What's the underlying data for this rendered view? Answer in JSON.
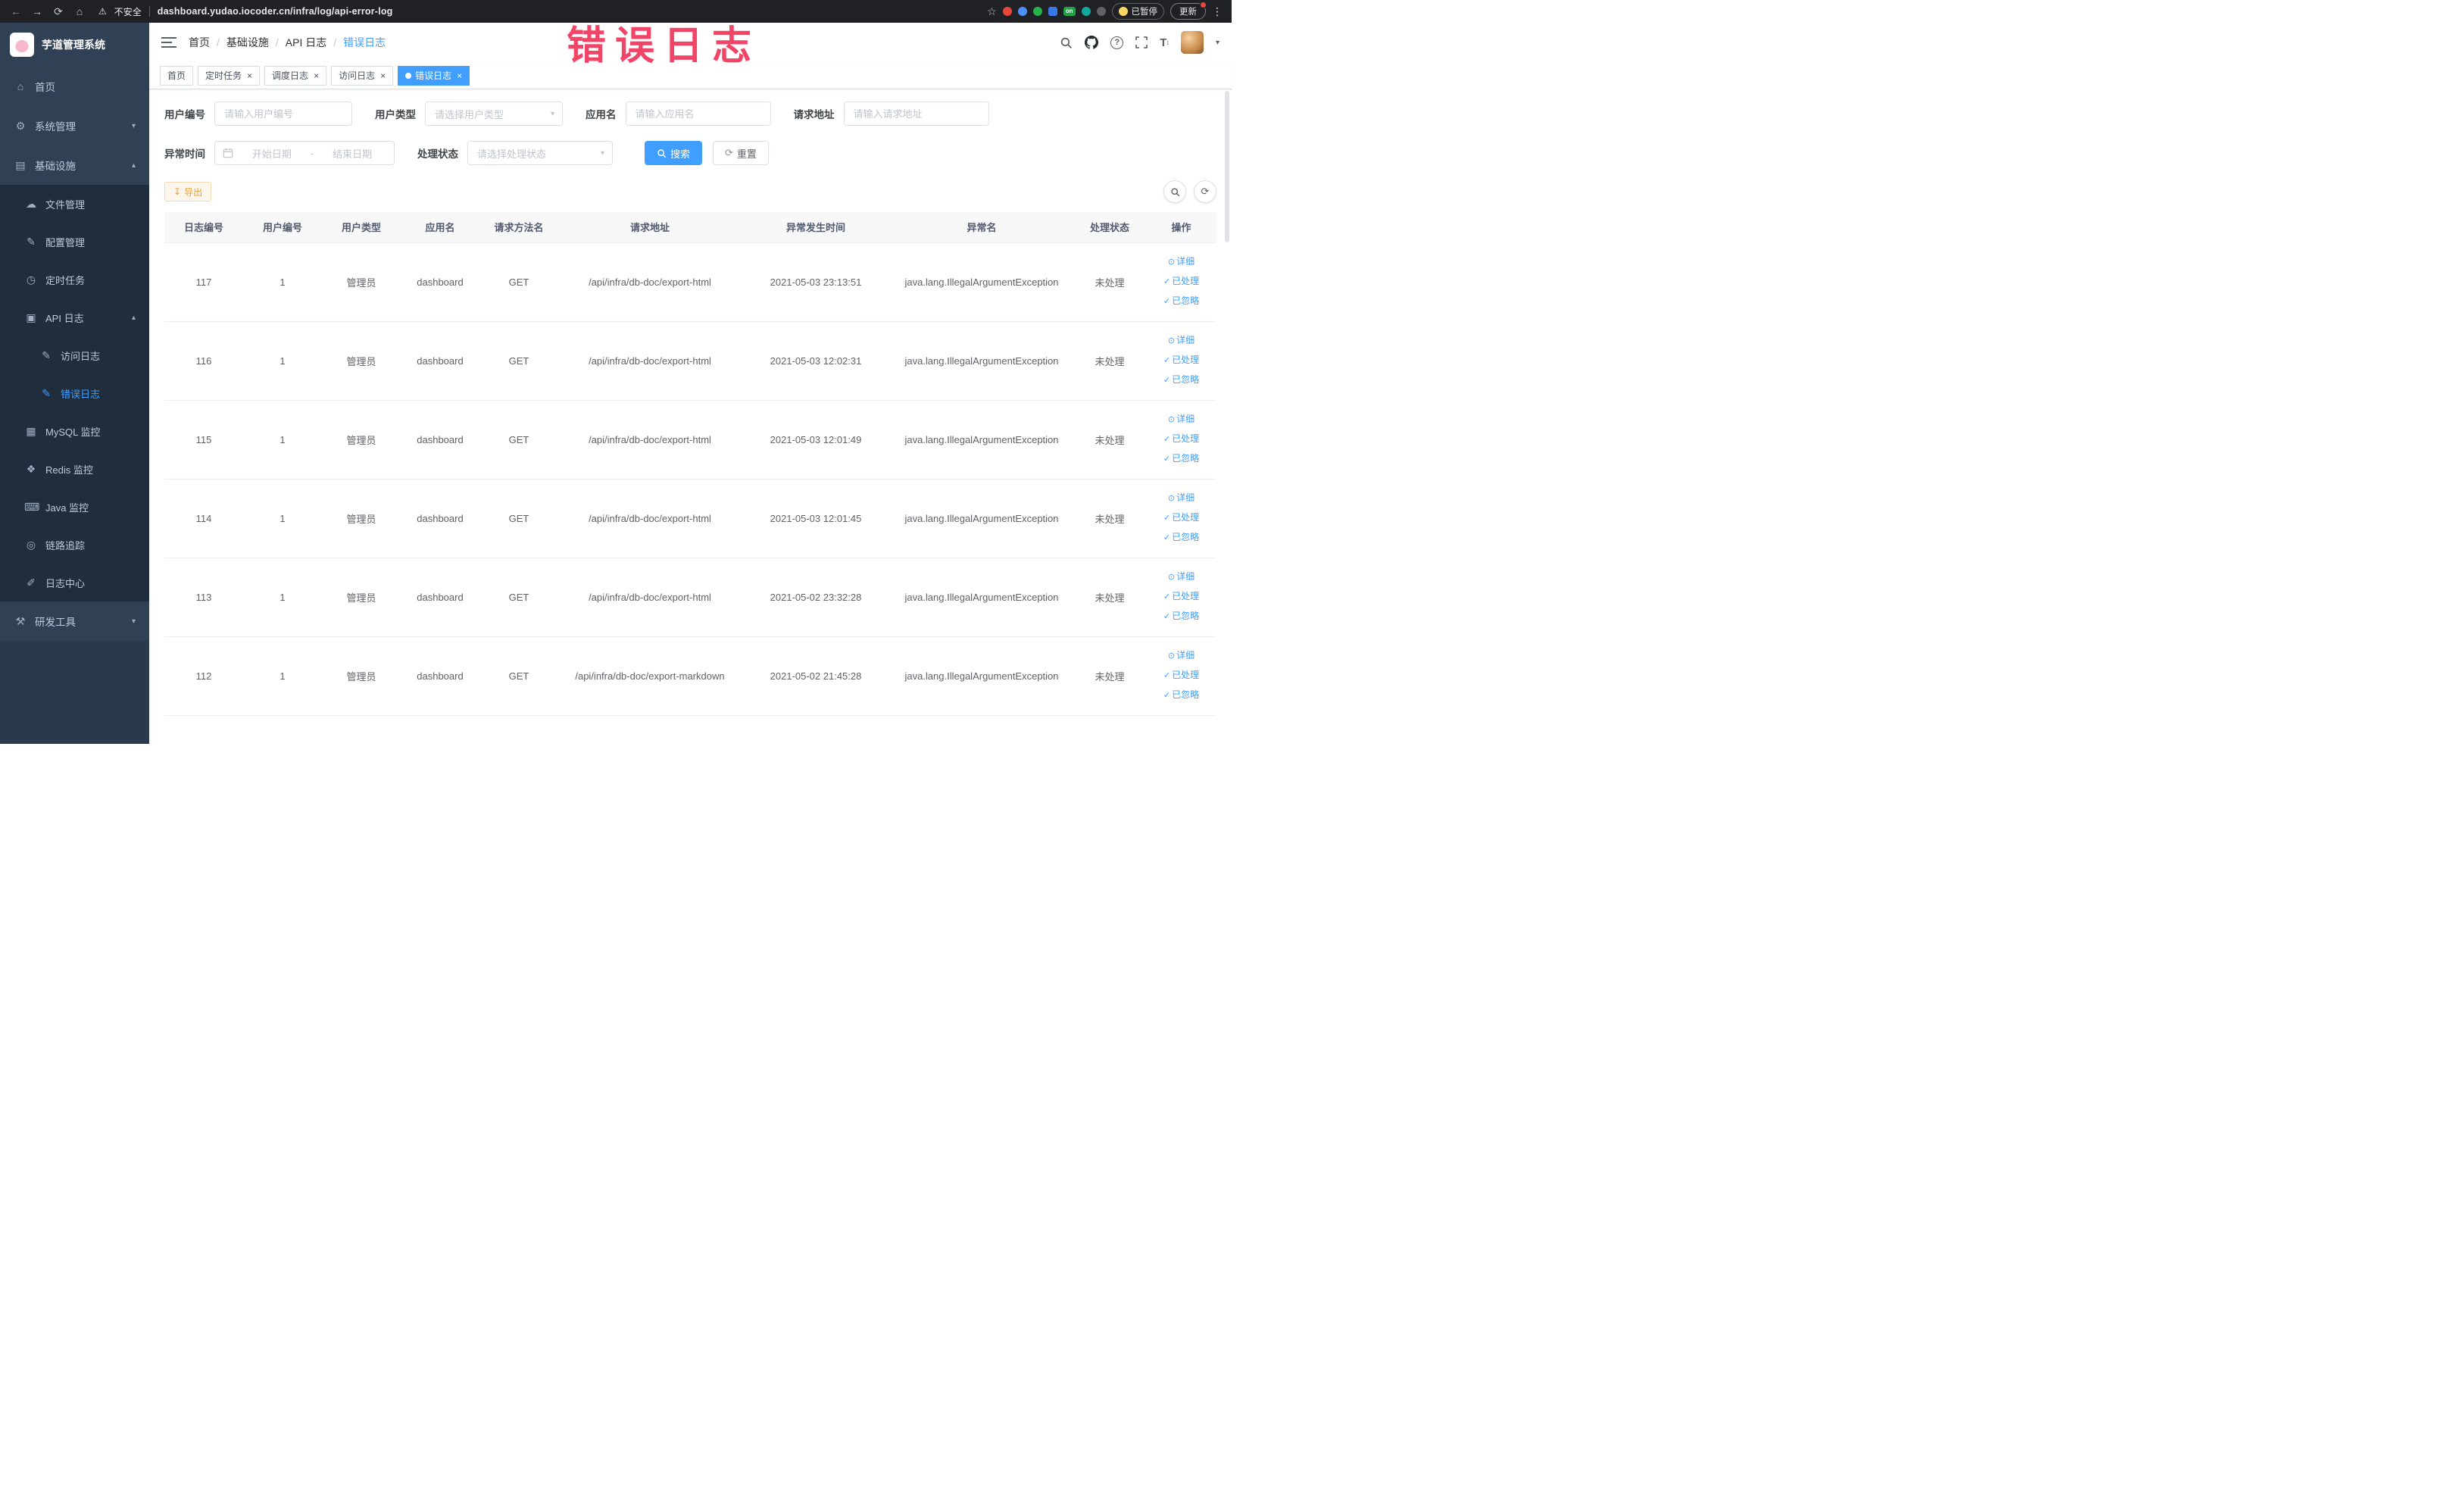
{
  "annotation": {
    "text": "错误日志"
  },
  "browser": {
    "security_label": "不安全",
    "url": "dashboard.yudao.iocoder.cn/infra/log/api-error-log",
    "on_badge": "on",
    "paused_label": "已暂停",
    "update_label": "更新"
  },
  "icons": {
    "back": "←",
    "forward": "→",
    "reload": "⟳",
    "home": "⌂",
    "warning": "⚠",
    "star": "☆",
    "more": "⋮",
    "gear": "⚙",
    "infra": "▤",
    "file": "☁",
    "config": "✎",
    "timer": "◷",
    "apilog": "▣",
    "log": "✎",
    "mysql": "▦",
    "redis": "❖",
    "java": "⌨",
    "trace": "◎",
    "logcenter": "✐",
    "tools": "⚒",
    "chevron_down": "▾",
    "chevron_up": "▴",
    "caret": "▾",
    "close": "×",
    "download": "↧",
    "refresh": "⟳",
    "view": "⊙",
    "check": "✓",
    "font_size": "T"
  },
  "sidebar": {
    "title": "芋道管理系统",
    "items": [
      {
        "label": "首页"
      },
      {
        "label": "系统管理"
      },
      {
        "label": "基础设施"
      },
      {
        "label": "文件管理"
      },
      {
        "label": "配置管理"
      },
      {
        "label": "定时任务"
      },
      {
        "label": "API 日志"
      },
      {
        "label": "访问日志"
      },
      {
        "label": "错误日志"
      },
      {
        "label": "MySQL 监控"
      },
      {
        "label": "Redis 监控"
      },
      {
        "label": "Java 监控"
      },
      {
        "label": "链路追踪"
      },
      {
        "label": "日志中心"
      },
      {
        "label": "研发工具"
      }
    ]
  },
  "header": {
    "breadcrumb": [
      "首页",
      "基础设施",
      "API 日志",
      "错误日志"
    ],
    "separator": "/"
  },
  "tabs": [
    {
      "label": "首页"
    },
    {
      "label": "定时任务"
    },
    {
      "label": "调度日志"
    },
    {
      "label": "访问日志"
    },
    {
      "label": "错误日志"
    }
  ],
  "filters": {
    "user_id_label": "用户编号",
    "user_id_placeholder": "请输入用户编号",
    "user_type_label": "用户类型",
    "user_type_placeholder": "请选择用户类型",
    "app_label": "应用名",
    "app_placeholder": "请输入应用名",
    "url_label": "请求地址",
    "url_placeholder": "请输入请求地址",
    "time_label": "异常时间",
    "date_start_placeholder": "开始日期",
    "range_separator": "-",
    "date_end_placeholder": "结束日期",
    "status_label": "处理状态",
    "status_placeholder": "请选择处理状态",
    "search_label": "搜索",
    "reset_label": "重置"
  },
  "toolbar": {
    "export_label": "导出"
  },
  "table": {
    "columns": [
      "日志编号",
      "用户编号",
      "用户类型",
      "应用名",
      "请求方法名",
      "请求地址",
      "异常发生时间",
      "异常名",
      "处理状态",
      "操作"
    ],
    "actions": {
      "detail": "详细",
      "processed": "已处理",
      "ignored": "已忽略"
    },
    "rows": [
      {
        "id": "117",
        "user": "1",
        "type": "管理员",
        "app": "dashboard",
        "method": "GET",
        "url": "/api/infra/db-doc/export-html",
        "time": "2021-05-03 23:13:51",
        "exception": "java.lang.IllegalArgumentException",
        "status": "未处理"
      },
      {
        "id": "116",
        "user": "1",
        "type": "管理员",
        "app": "dashboard",
        "method": "GET",
        "url": "/api/infra/db-doc/export-html",
        "time": "2021-05-03 12:02:31",
        "exception": "java.lang.IllegalArgumentException",
        "status": "未处理"
      },
      {
        "id": "115",
        "user": "1",
        "type": "管理员",
        "app": "dashboard",
        "method": "GET",
        "url": "/api/infra/db-doc/export-html",
        "time": "2021-05-03 12:01:49",
        "exception": "java.lang.IllegalArgumentException",
        "status": "未处理"
      },
      {
        "id": "114",
        "user": "1",
        "type": "管理员",
        "app": "dashboard",
        "method": "GET",
        "url": "/api/infra/db-doc/export-html",
        "time": "2021-05-03 12:01:45",
        "exception": "java.lang.IllegalArgumentException",
        "status": "未处理"
      },
      {
        "id": "113",
        "user": "1",
        "type": "管理员",
        "app": "dashboard",
        "method": "GET",
        "url": "/api/infra/db-doc/export-html",
        "time": "2021-05-02 23:32:28",
        "exception": "java.lang.IllegalArgumentException",
        "status": "未处理"
      },
      {
        "id": "112",
        "user": "1",
        "type": "管理员",
        "app": "dashboard",
        "method": "GET",
        "url": "/api/infra/db-doc/export-markdown",
        "time": "2021-05-02 21:45:28",
        "exception": "java.lang.IllegalArgumentException",
        "status": "未处理"
      }
    ]
  }
}
